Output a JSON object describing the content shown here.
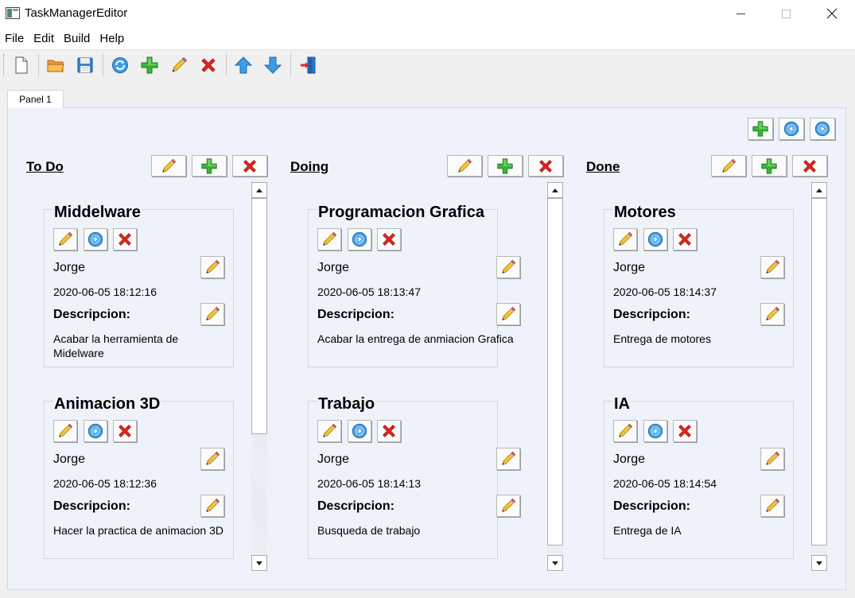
{
  "window": {
    "title": "TaskManagerEditor"
  },
  "menu": {
    "file": "File",
    "edit": "Edit",
    "build": "Build",
    "help": "Help"
  },
  "tabs": [
    {
      "label": "Panel 1"
    }
  ],
  "columns": [
    {
      "title": "To Do",
      "cards": [
        {
          "title": "Middelware",
          "user": "Jorge",
          "date": "2020-06-05 18:12:16",
          "desc_label": "Descripcion:",
          "desc": "Acabar la herramienta de Midelware"
        },
        {
          "title": "Animacion 3D",
          "user": "Jorge",
          "date": "2020-06-05 18:12:36",
          "desc_label": "Descripcion:",
          "desc": "Hacer la practica de animacion 3D"
        }
      ]
    },
    {
      "title": "Doing",
      "cards": [
        {
          "title": "Programacion Grafica",
          "user": "Jorge",
          "date": "2020-06-05 18:13:47",
          "desc_label": "Descripcion:",
          "desc": "Acabar la entrega de anmiacion Grafica"
        },
        {
          "title": "Trabajo",
          "user": "Jorge",
          "date": "2020-06-05 18:14:13",
          "desc_label": "Descripcion:",
          "desc": "Busqueda de trabajo"
        }
      ]
    },
    {
      "title": "Done",
      "cards": [
        {
          "title": "Motores",
          "user": "Jorge",
          "date": "2020-06-05 18:14:37",
          "desc_label": "Descripcion:",
          "desc": "Entrega de motores"
        },
        {
          "title": "IA",
          "user": "Jorge",
          "date": "2020-06-05 18:14:54",
          "desc_label": "Descripcion:",
          "desc": "Entrega de IA"
        }
      ]
    }
  ],
  "colors": {
    "panel_bg": "#eef2fb",
    "add": "#2ea82e",
    "delete": "#e0201c",
    "arrow": "#2f8ee0",
    "pencil": "#f5c322"
  }
}
